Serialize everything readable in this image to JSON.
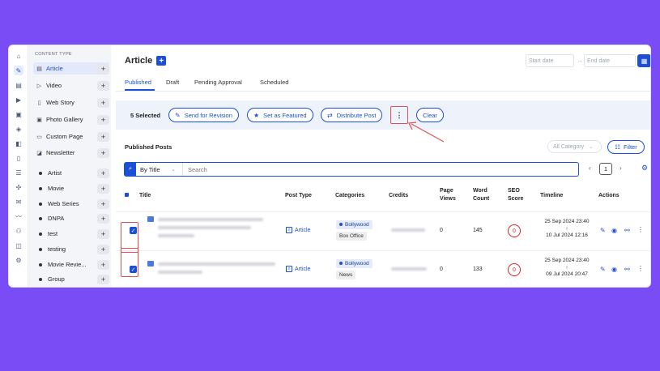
{
  "rail_icons": [
    "home-icon",
    "edit-icon",
    "document-icon",
    "play-icon",
    "image-icon",
    "tag-icon",
    "media-icon",
    "file-icon",
    "list-icon",
    "expand-icon",
    "mail-icon",
    "chart-icon",
    "users-icon",
    "layers-icon",
    "settings-icon"
  ],
  "sidebar": {
    "heading": "CONTENT TYPE",
    "types": [
      {
        "label": "Article",
        "icon": "article-icon",
        "active": true
      },
      {
        "label": "Video",
        "icon": "video-icon"
      },
      {
        "label": "Web Story",
        "icon": "web-story-icon"
      },
      {
        "label": "Photo Gallery",
        "icon": "gallery-icon"
      },
      {
        "label": "Custom Page",
        "icon": "custom-page-icon"
      },
      {
        "label": "Newsletter",
        "icon": "newsletter-icon"
      }
    ],
    "taxonomies": [
      "Artist",
      "Movie",
      "Web Series",
      "DNPA",
      "test",
      "testing",
      "Movie Revie...",
      "Group"
    ]
  },
  "header": {
    "title": "Article",
    "start_date_placeholder": "Start date",
    "end_date_placeholder": "End date",
    "date_separator": "→"
  },
  "tabs": [
    "Published",
    "Draft",
    "Pending Approval",
    "Scheduled"
  ],
  "bulk": {
    "selected": "5 Selected",
    "send_revision": "Send for Revision",
    "set_featured": "Set as Featured",
    "distribute": "Distribute Post",
    "more": "⋮",
    "clear": "Clear"
  },
  "posts": {
    "heading": "Published Posts",
    "category_placeholder": "All Category",
    "filter_label": "Filter",
    "search_by": "By Title",
    "search_placeholder": "Search",
    "page": "1",
    "columns": {
      "title": "Title",
      "post_type": "Post Type",
      "categories": "Categories",
      "credits": "Credits",
      "page_views_1": "Page",
      "page_views_2": "Views",
      "word_count_1": "Word",
      "word_count_2": "Count",
      "seo_1": "SEO",
      "seo_2": "Score",
      "timeline": "Timeline",
      "actions": "Actions"
    },
    "rows": [
      {
        "post_type": "Article",
        "category": "Bollywood",
        "subcategory": "Box Office",
        "views": "0",
        "words": "145",
        "seo": "0",
        "t1": "25 Sep 2024 23:40",
        "arrow": "↑",
        "t2": "10 Jul 2024 12:16"
      },
      {
        "post_type": "Article",
        "category": "Bollywood",
        "subcategory": "News",
        "views": "0",
        "words": "133",
        "seo": "0",
        "t1": "25 Sep 2024 23:40",
        "arrow": "↑",
        "t2": "09 Jul 2024 20:47"
      }
    ]
  },
  "colors": {
    "accent": "#1a4fd6",
    "highlight": "#e05050",
    "background": "#7a4cf5"
  }
}
